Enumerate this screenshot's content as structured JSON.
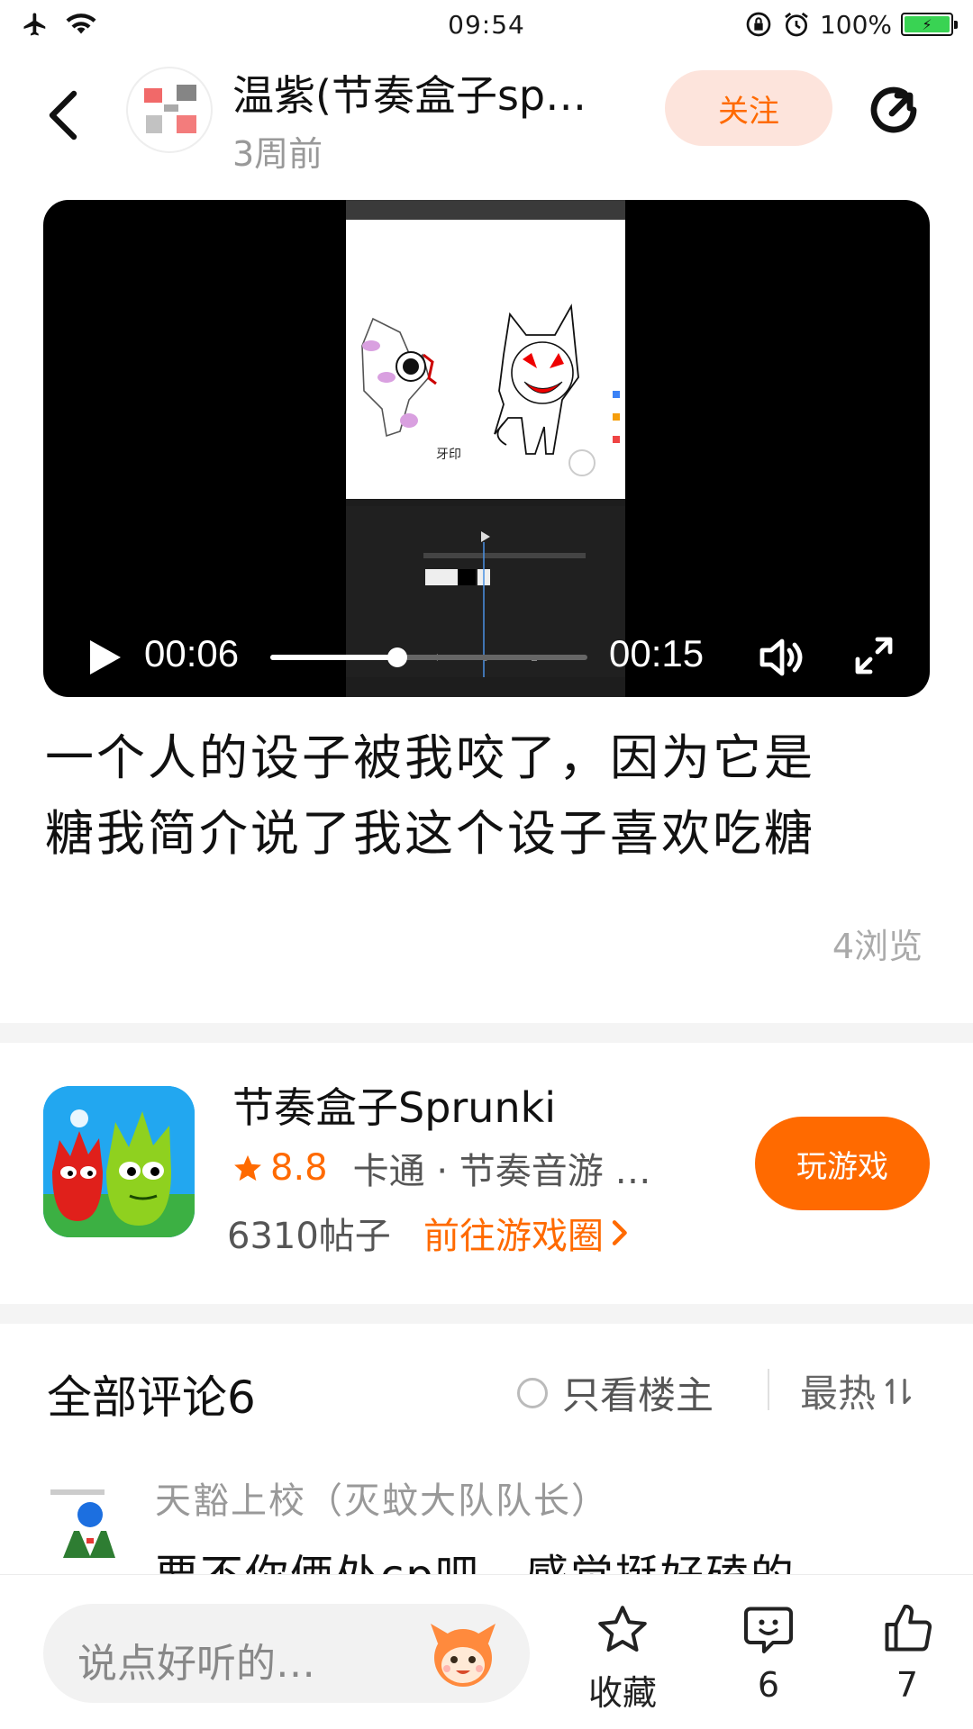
{
  "status_bar": {
    "time": "09:54",
    "battery": "100%",
    "icons": [
      "airplane-icon",
      "wifi-icon",
      "lock-rotation-icon",
      "alarm-icon",
      "battery-icon"
    ]
  },
  "header": {
    "author_name": "温紫(节奏盒子sp…",
    "post_time": "3周前",
    "follow_label": "关注",
    "icons": [
      "back-icon",
      "share-icon"
    ]
  },
  "video": {
    "current_time": "00:06",
    "total_time": "00:15",
    "progress": 0.4,
    "frame_caption": "牙印",
    "icons": [
      "play-icon",
      "volume-icon",
      "fullscreen-icon"
    ]
  },
  "post": {
    "text_line1": "一个人的设子被我咬了，因为它是",
    "text_line2": "糖我简介说了我这个设子喜欢吃糖",
    "views": "4浏览"
  },
  "game": {
    "title": "节奏盒子Sprunki",
    "rating": "8.8",
    "tags": "卡通 · 节奏音游 …",
    "posts": "6310帖子",
    "circle_link": "前往游戏圈",
    "play_label": "玩游戏",
    "colors": {
      "accent": "#ff6a00",
      "star": "#ff6a00"
    }
  },
  "comments": {
    "title": "全部评论6",
    "owner_only": "只看楼主",
    "sort_label": "最热",
    "items": [
      {
        "user": "天豁上校（灭蚊大队队长）",
        "text": "要不你俩处cp吧，感觉挺好磕的"
      }
    ]
  },
  "bottom_bar": {
    "input_placeholder": "说点好听的…",
    "favorite_label": "收藏",
    "comment_count": "6",
    "like_count": "7"
  }
}
